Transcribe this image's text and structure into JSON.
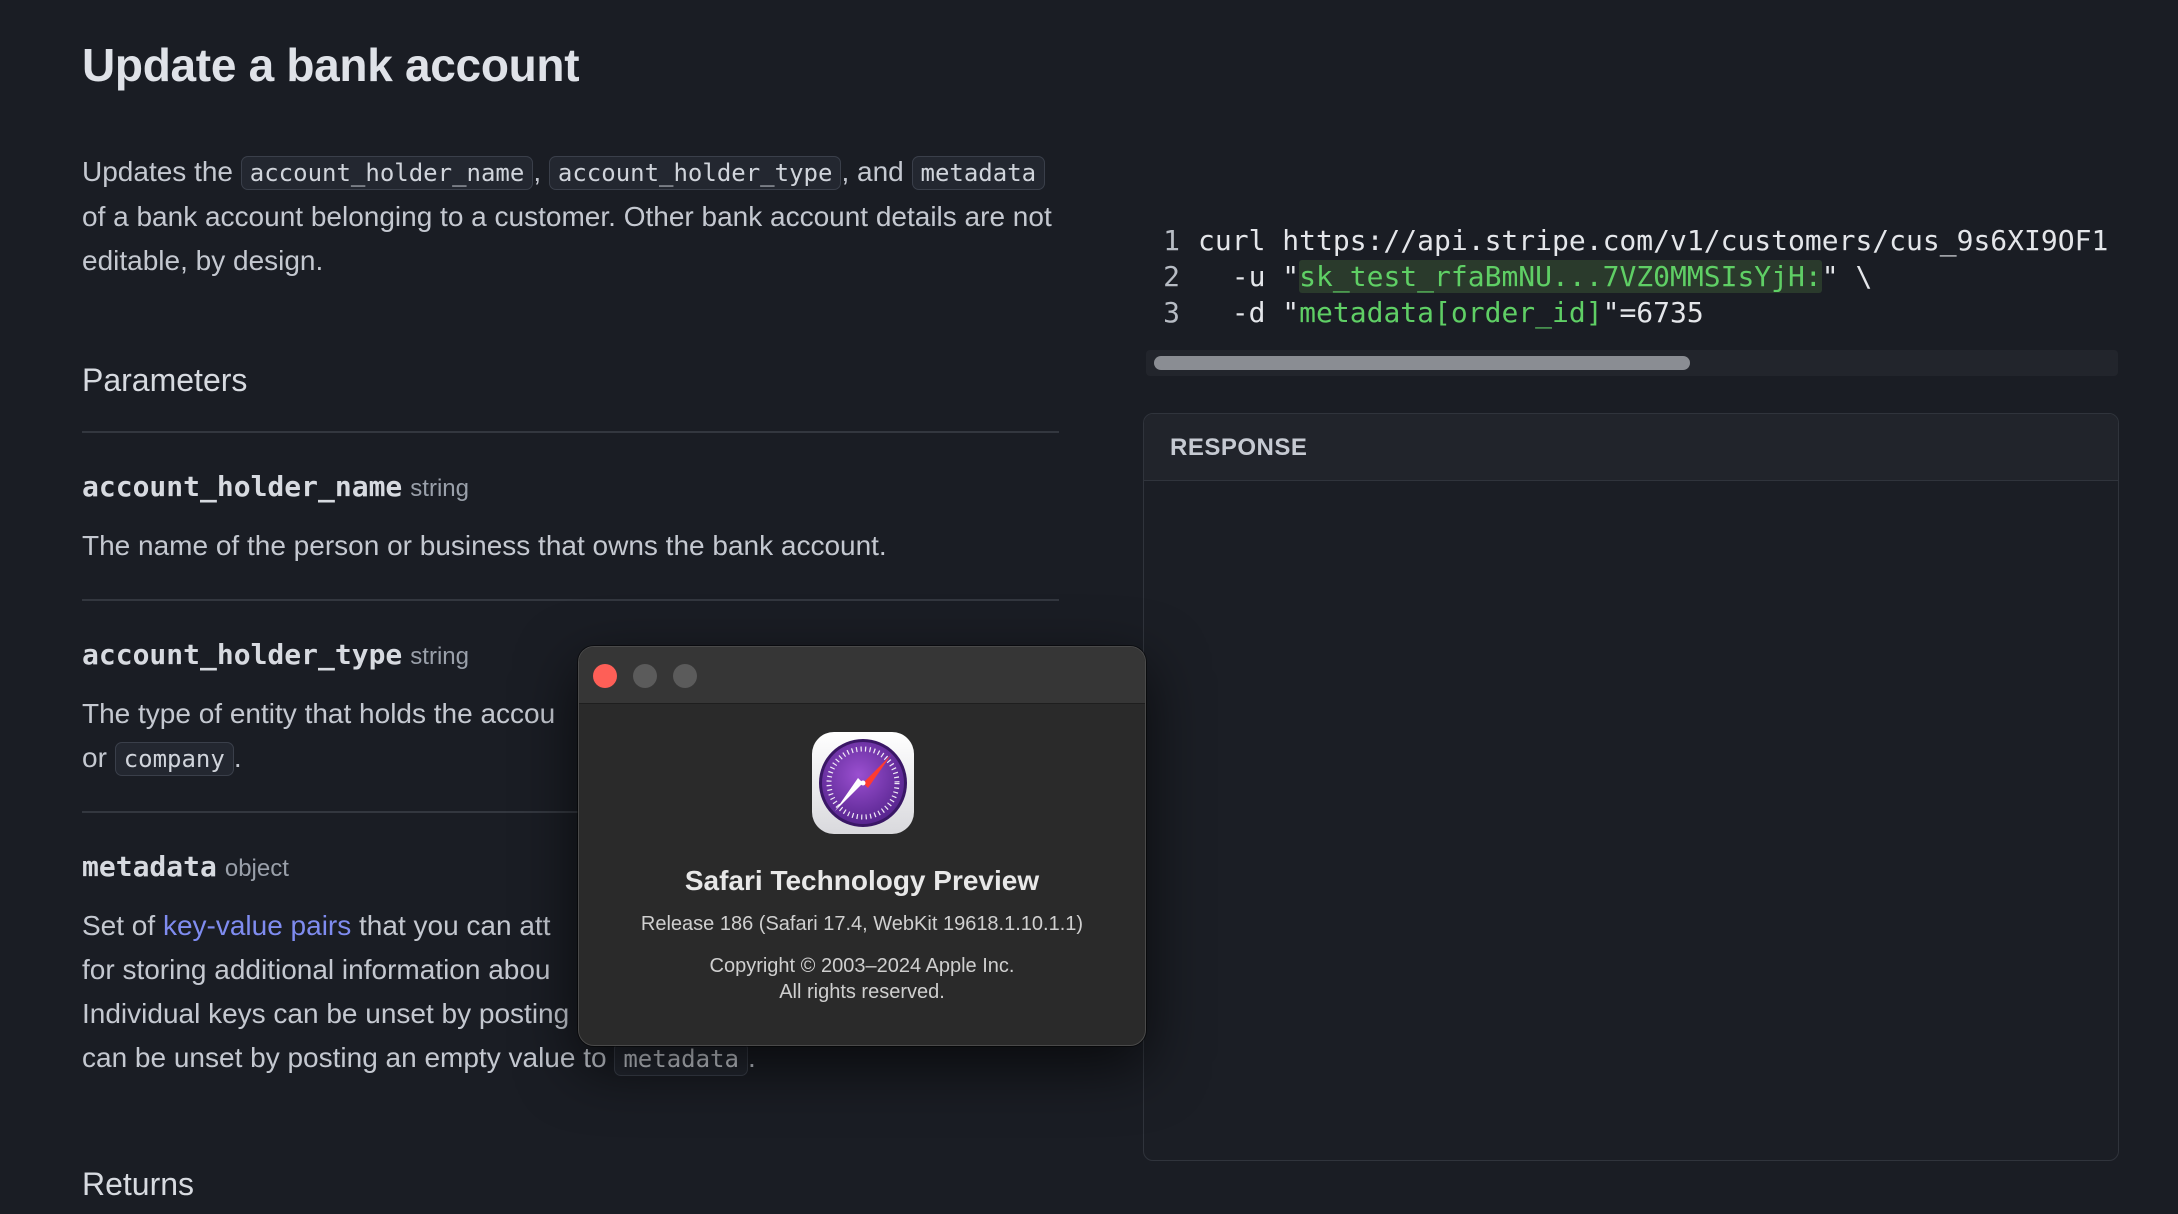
{
  "doc": {
    "title": "Update a bank account",
    "desc": {
      "p1": "Updates the ",
      "code1": "account_holder_name",
      "p2": ", ",
      "code2": "account_holder_type",
      "p3": ", and ",
      "code3": "metadata",
      "p4": " of a bank account belonging to a customer. Other bank account details are not editable, by design."
    },
    "parameters_heading": "Parameters",
    "params": [
      {
        "name": "account_holder_name",
        "type": "string",
        "desc": "The name of the person or business that owns the bank account."
      },
      {
        "name": "account_holder_type",
        "type": "string",
        "desc_a": "The type of entity that holds the accou",
        "desc_b": "or ",
        "desc_code": "company",
        "desc_c": "."
      },
      {
        "name": "metadata",
        "type": "object",
        "line1_a": "Set of ",
        "line1_link": "key-value pairs",
        "line1_b": " that you can att",
        "line2": "for storing additional information abou",
        "line3": "Individual keys can be unset by posting",
        "line4_a": "can be unset by posting an empty value to ",
        "line4_code": "metadata",
        "line4_b": "."
      }
    ],
    "returns_heading": "Returns"
  },
  "code_sample": {
    "lines": [
      {
        "num": "1",
        "text": "curl https://api.stripe.com/v1/customers/cus_9s6XI9OF1"
      },
      {
        "num": "2",
        "pre": "  -u \"",
        "key": "sk_test_rfaBmNU...7VZ0MMSIsYjH:",
        "post": "\" \\"
      },
      {
        "num": "3",
        "pre": "  -d \"",
        "str": "metadata[order_id]",
        "post": "\"=6735"
      }
    ]
  },
  "response": {
    "label": "RESPONSE"
  },
  "about_dialog": {
    "app_name": "Safari Technology Preview",
    "release": "Release 186 (Safari 17.4, WebKit 19618.1.10.1.1)",
    "copyright": "Copyright © 2003–2024 Apple Inc.",
    "rights": "All rights reserved."
  },
  "colors": {
    "background": "#1a1d24",
    "link": "#7f8cf0",
    "code_string": "#5fcf65",
    "close_button": "#fe5f57"
  }
}
